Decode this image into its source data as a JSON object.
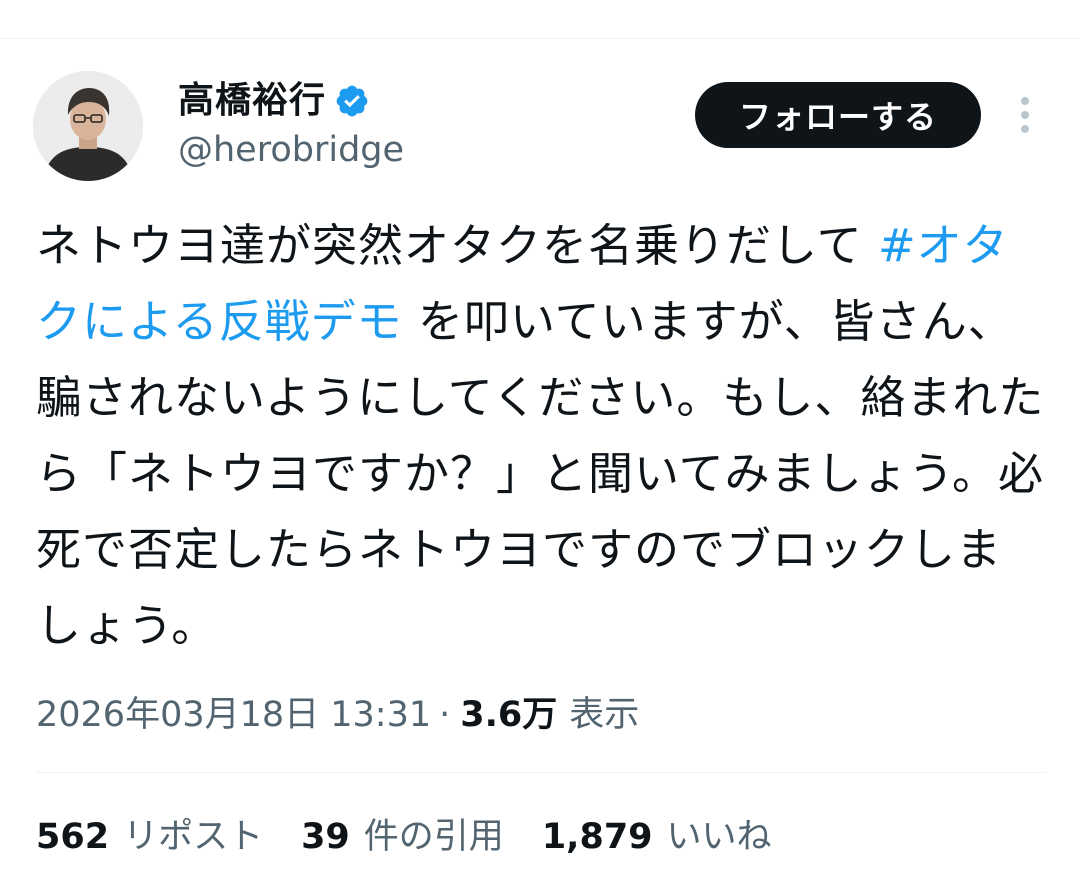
{
  "author": {
    "display_name": "高橋裕行",
    "handle": "@herobridge",
    "verified": true,
    "verified_color": "#1d9bf0"
  },
  "follow_button": {
    "label": "フォローする"
  },
  "more_menu": {
    "icon": "more-vertical-icon"
  },
  "tweet": {
    "text_before_hashtag": "ネトウヨ達が突然オタクを名乗りだして ",
    "hashtag": "#オタクによる反戦デモ",
    "text_after_hashtag": " を叩いていますが、皆さん、騙されないようにしてください。もし、絡まれたら「ネトウヨですか？」と聞いてみましょう。必死で否定したらネトウヨですのでブロックしましょう。"
  },
  "meta": {
    "timestamp": "2026年03月18日 13:31",
    "separator": "·",
    "views_count": "3.6万",
    "views_label": "表示"
  },
  "stats": {
    "reposts": {
      "count": "562",
      "label": "リポスト"
    },
    "quotes": {
      "count": "39",
      "label": "件の引用"
    },
    "likes": {
      "count": "1,879",
      "label": "いいね"
    }
  },
  "colors": {
    "text_primary": "#0f1419",
    "text_secondary": "#536471",
    "link": "#1d9bf0",
    "button_bg": "#0f1419",
    "divider": "#eff3f4"
  }
}
